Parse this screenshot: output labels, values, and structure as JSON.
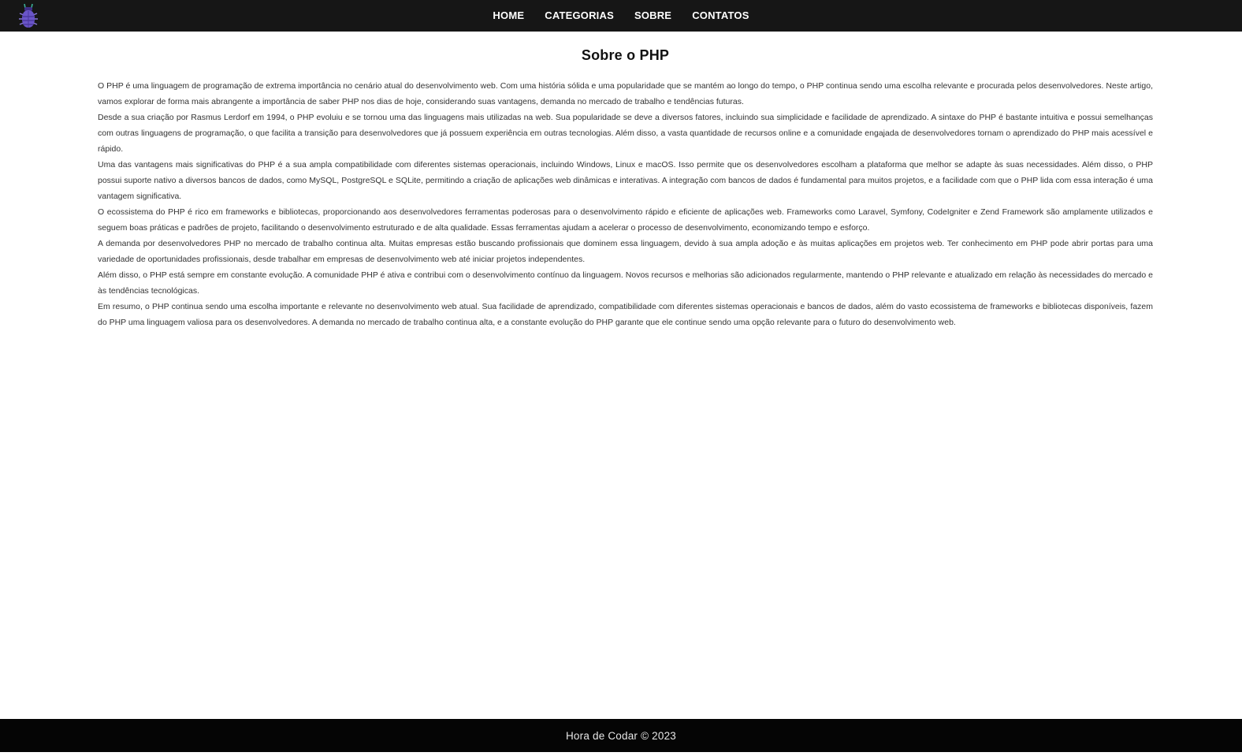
{
  "header": {
    "logo_icon": "bug-icon",
    "nav": [
      {
        "label": "HOME"
      },
      {
        "label": "CATEGORIAS"
      },
      {
        "label": "SOBRE"
      },
      {
        "label": "CONTATOS"
      }
    ]
  },
  "main": {
    "title": "Sobre o PHP",
    "paragraphs": [
      "O PHP é uma linguagem de programação de extrema importância no cenário atual do desenvolvimento web. Com uma história sólida e uma popularidade que se mantém ao longo do tempo, o PHP continua sendo uma escolha relevante e procurada pelos desenvolvedores. Neste artigo, vamos explorar de forma mais abrangente a importância de saber PHP nos dias de hoje, considerando suas vantagens, demanda no mercado de trabalho e tendências futuras.",
      "Desde a sua criação por Rasmus Lerdorf em 1994, o PHP evoluiu e se tornou uma das linguagens mais utilizadas na web. Sua popularidade se deve a diversos fatores, incluindo sua simplicidade e facilidade de aprendizado. A sintaxe do PHP é bastante intuitiva e possui semelhanças com outras linguagens de programação, o que facilita a transição para desenvolvedores que já possuem experiência em outras tecnologias. Além disso, a vasta quantidade de recursos online e a comunidade engajada de desenvolvedores tornam o aprendizado do PHP mais acessível e rápido.",
      "Uma das vantagens mais significativas do PHP é a sua ampla compatibilidade com diferentes sistemas operacionais, incluindo Windows, Linux e macOS. Isso permite que os desenvolvedores escolham a plataforma que melhor se adapte às suas necessidades. Além disso, o PHP possui suporte nativo a diversos bancos de dados, como MySQL, PostgreSQL e SQLite, permitindo a criação de aplicações web dinâmicas e interativas. A integração com bancos de dados é fundamental para muitos projetos, e a facilidade com que o PHP lida com essa interação é uma vantagem significativa.",
      "O ecossistema do PHP é rico em frameworks e bibliotecas, proporcionando aos desenvolvedores ferramentas poderosas para o desenvolvimento rápido e eficiente de aplicações web. Frameworks como Laravel, Symfony, CodeIgniter e Zend Framework são amplamente utilizados e seguem boas práticas e padrões de projeto, facilitando o desenvolvimento estruturado e de alta qualidade. Essas ferramentas ajudam a acelerar o processo de desenvolvimento, economizando tempo e esforço.",
      "A demanda por desenvolvedores PHP no mercado de trabalho continua alta. Muitas empresas estão buscando profissionais que dominem essa linguagem, devido à sua ampla adoção e às muitas aplicações em projetos web. Ter conhecimento em PHP pode abrir portas para uma variedade de oportunidades profissionais, desde trabalhar em empresas de desenvolvimento web até iniciar projetos independentes.",
      "Além disso, o PHP está sempre em constante evolução. A comunidade PHP é ativa e contribui com o desenvolvimento contínuo da linguagem. Novos recursos e melhorias são adicionados regularmente, mantendo o PHP relevante e atualizado em relação às necessidades do mercado e às tendências tecnológicas.",
      "Em resumo, o PHP continua sendo uma escolha importante e relevante no desenvolvimento web atual. Sua facilidade de aprendizado, compatibilidade com diferentes sistemas operacionais e bancos de dados, além do vasto ecossistema de frameworks e bibliotecas disponíveis, fazem do PHP uma linguagem valiosa para os desenvolvedores. A demanda no mercado de trabalho continua alta, e a constante evolução do PHP garante que ele continue sendo uma opção relevante para o futuro do desenvolvimento web."
    ]
  },
  "footer": {
    "text": "Hora de Codar © 2023"
  },
  "colors": {
    "navbar": "#161616",
    "footer": "#050505",
    "logo": "#6a55c9"
  }
}
